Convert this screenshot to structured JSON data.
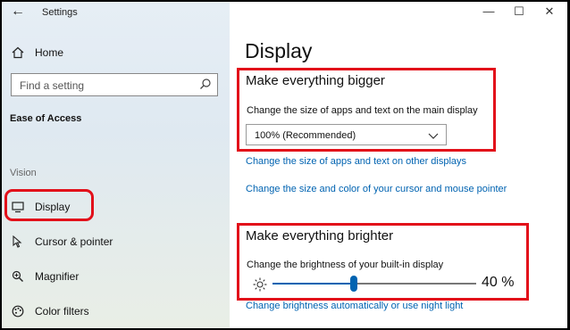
{
  "window": {
    "title": "Settings",
    "back_label": "←",
    "minimize_label": "—",
    "maximize_label": "☐",
    "close_label": "✕"
  },
  "sidebar": {
    "home_label": "Home",
    "search_placeholder": "Find a setting",
    "section_title": "Ease of Access",
    "group_label": "Vision",
    "items": [
      {
        "label": "Display",
        "icon": "monitor-icon",
        "selected": true
      },
      {
        "label": "Cursor & pointer",
        "icon": "cursor-icon",
        "selected": false
      },
      {
        "label": "Magnifier",
        "icon": "magnifier-icon",
        "selected": false
      },
      {
        "label": "Color filters",
        "icon": "palette-icon",
        "selected": false
      }
    ]
  },
  "main": {
    "page_title": "Display",
    "bigger": {
      "heading": "Make everything bigger",
      "description": "Change the size of apps and text on the main display",
      "dropdown_value": "100% (Recommended)"
    },
    "links": {
      "other_displays": "Change the size of apps and text on other displays",
      "cursor": "Change the size and color of your cursor and mouse pointer",
      "night_light": "Change brightness automatically or use night light"
    },
    "brighter": {
      "heading": "Make everything brighter",
      "description": "Change the brightness of your built-in display",
      "brightness_value": 40,
      "brightness_label": "40 %"
    }
  },
  "colors": {
    "highlight": "#e2101a",
    "accent": "#0063b1"
  }
}
